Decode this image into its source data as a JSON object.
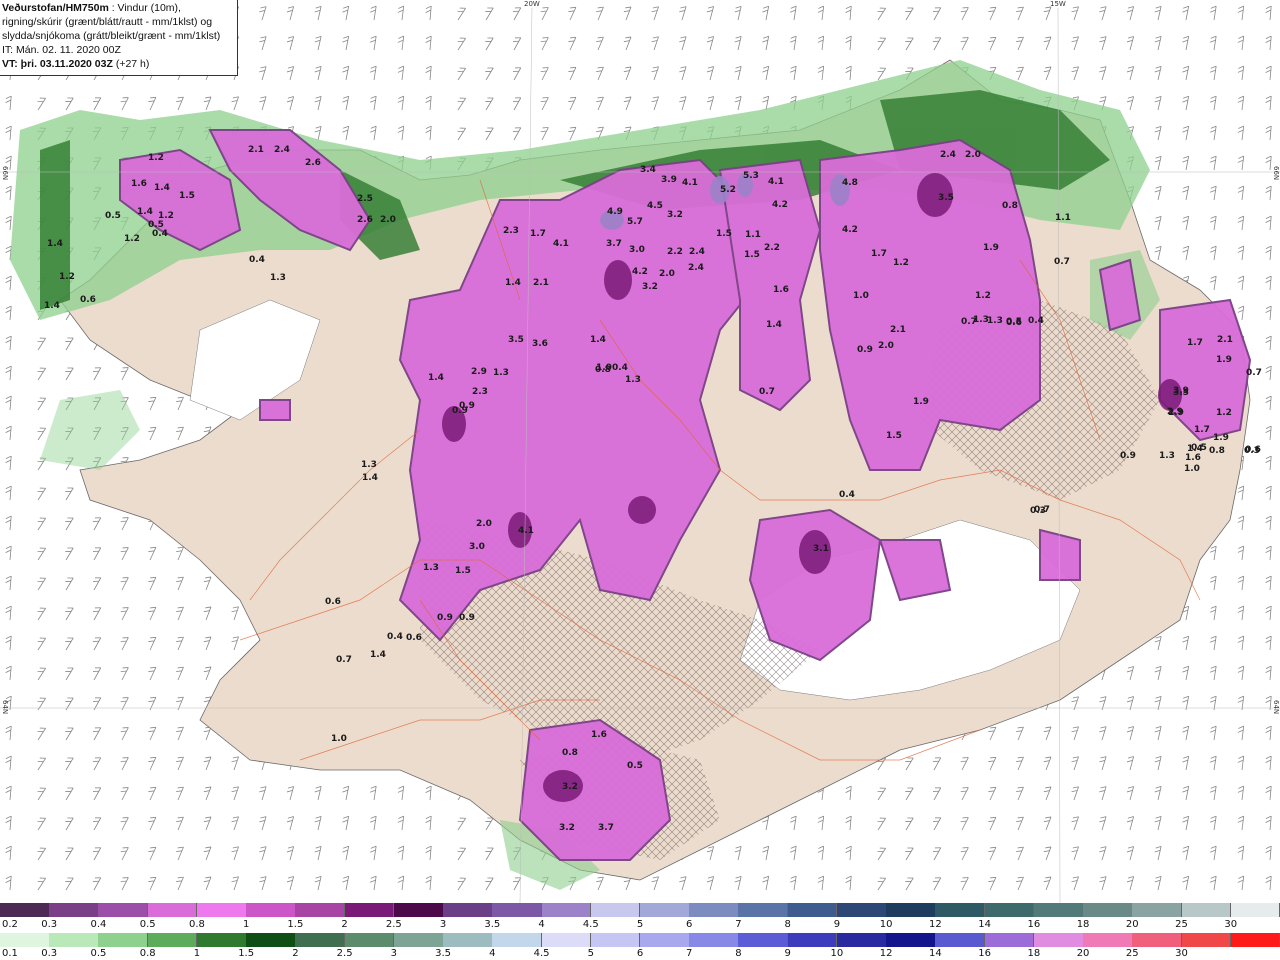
{
  "header": {
    "line1_bold": "Veðurstofan/HM750m",
    "line1_rest": " : Vindur (10m),",
    "line2": "rigning/skúrir (grænt/blátt/rautt - mm/1klst) og",
    "line3": "slydda/snjókoma (grátt/bleikt/grænt - mm/1klst)",
    "line4": "IT: Mán. 02. 11. 2020 00Z",
    "line5_bold": "VT: þri. 03.11.2020 03Z",
    "line5_rest": " (+27 h)"
  },
  "coords": {
    "top_left": "20W",
    "top_right": "15W",
    "left_top": "66N",
    "left_bottom": "64N",
    "right_top": "66N",
    "right_bottom": "64N"
  },
  "legend_snow": {
    "labels": [
      "0.2",
      "0.3",
      "0.4",
      "0.5",
      "0.8",
      "1",
      "1.5",
      "2",
      "2.5",
      "3",
      "3.5",
      "4",
      "4.5",
      "5",
      "6",
      "7",
      "8",
      "9",
      "10",
      "12",
      "14",
      "16",
      "18",
      "20",
      "25",
      "30"
    ],
    "colors": [
      "#4d2a55",
      "#7a3f86",
      "#9b4fa9",
      "#d96cd8",
      "#ee78ee",
      "#cc55c8",
      "#a844a4",
      "#7a1a78",
      "#4d0a4b",
      "#6b3f88",
      "#7c58a6",
      "#9c82c8",
      "#c8c8ee",
      "#a2a8d8",
      "#7d8cc0",
      "#5a74a8",
      "#3f5c90",
      "#2d4876",
      "#1e3d5e",
      "#2e5a66",
      "#3f6a6c",
      "#527a78",
      "#6a8a88",
      "#8aa4a4",
      "#b8c8c8",
      "#e6ecec"
    ]
  },
  "legend_rain": {
    "labels": [
      "0.1",
      "0.3",
      "0.5",
      "0.8",
      "1",
      "1.5",
      "2",
      "2.5",
      "3",
      "3.5",
      "4",
      "4.5",
      "5",
      "6",
      "7",
      "8",
      "9",
      "10",
      "12",
      "14",
      "16",
      "18",
      "20",
      "25",
      "30"
    ],
    "colors": [
      "#dff5df",
      "#b9e8b9",
      "#8ed08e",
      "#5cac5c",
      "#2e7a2e",
      "#0f4f16",
      "#3f6f4f",
      "#5c8c6c",
      "#7ea496",
      "#9cbcc0",
      "#c2d8ea",
      "#dcdcf8",
      "#c6c6f4",
      "#a8a8ee",
      "#8888e6",
      "#5c5cd6",
      "#3c3cbc",
      "#2a2aa0",
      "#14148c",
      "#5a5ad0",
      "#9c6cd8",
      "#e08ce0",
      "#f07ab6",
      "#f0607c",
      "#f04848",
      "#ff1a1a"
    ]
  },
  "precip_labels": [
    "2.1",
    "2.4",
    "2.6",
    "2.5",
    "2.6",
    "2.0",
    "1.4",
    "1.2",
    "1.6",
    "1.5",
    "1.4",
    "1.2",
    "1.2",
    "0.5",
    "0.5",
    "0.4",
    "1.4",
    "1.2",
    "0.6",
    "1.4",
    "0.4",
    "1.3",
    "2.3",
    "1.7",
    "4.1",
    "2.1",
    "3.5",
    "1.3",
    "1.4",
    "3.6",
    "1.4",
    "3.4",
    "3.9",
    "4.1",
    "4.9",
    "5.7",
    "4.5",
    "3.2",
    "3.7",
    "3.0",
    "4.2",
    "3.2",
    "2.0",
    "2.2",
    "2.4",
    "2.4",
    "1.5",
    "5.2",
    "5.3",
    "4.1",
    "4.2",
    "4.8",
    "4.2",
    "1.1",
    "2.2",
    "1.5",
    "1.6",
    "1.4",
    "2.4",
    "2.0",
    "3.5",
    "1.7",
    "1.2",
    "1.9",
    "1.0",
    "1.2",
    "0.7",
    "2.1",
    "2.0",
    "1.9",
    "1.5",
    "0.9",
    "0.8",
    "1.3",
    "1.3",
    "0.6",
    "1.1",
    "2.1",
    "3.5",
    "1.9",
    "1.2",
    "2.9",
    "0.7",
    "1.9",
    "1.7",
    "1.4",
    "1.3",
    "1.0",
    "0.8",
    "0.6",
    "0.9",
    "2.9",
    "1.4",
    "0.9",
    "2.3",
    "2.0",
    "3.0",
    "4.1",
    "1.5",
    "1.3",
    "0.9",
    "0.9",
    "1.0",
    "1.3",
    "3.1",
    "1.3",
    "1.4",
    "0.4",
    "0.7",
    "0.3",
    "1.7",
    "3.9",
    "2.9",
    "0.5",
    "1.6",
    "0.8",
    "1.6",
    "3.2",
    "0.5",
    "3.2",
    "3.7",
    "0.8",
    "0.4",
    "0.4",
    "0.6",
    "0.7",
    "1.4",
    "0.9",
    "0.7",
    "0.3",
    "1.0",
    "0.6",
    "0.4",
    "0.5",
    "0.7"
  ]
}
